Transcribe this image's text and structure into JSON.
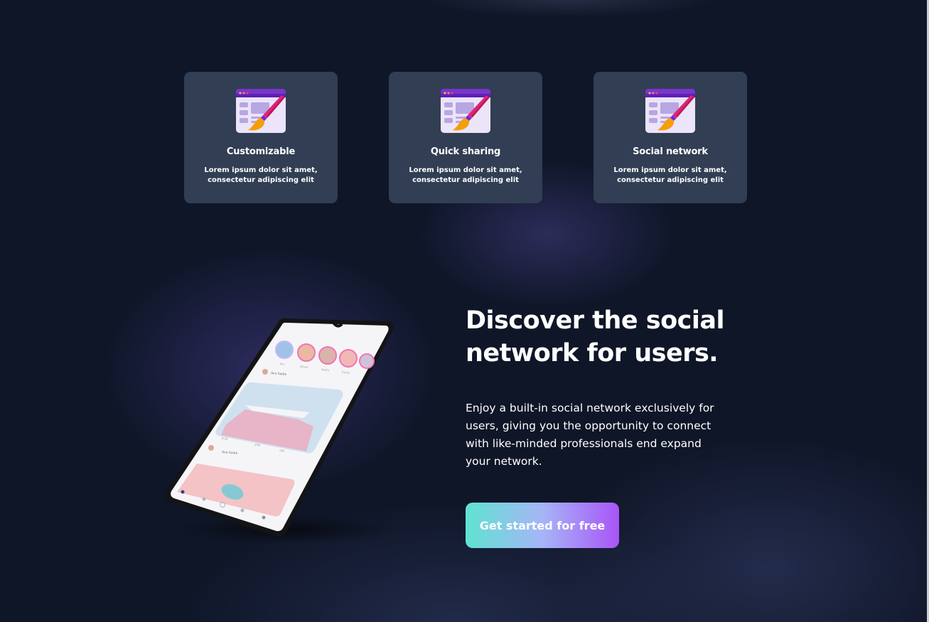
{
  "features": [
    {
      "title": "Customizable",
      "text": "Lorem ipsum dolor sit amet,\nconsectetur adipiscing elit",
      "icon": "browser-paintbrush-icon"
    },
    {
      "title": "Quick sharing",
      "text": "Lorem ipsum dolor sit amet,\nconsectetur adipiscing elit",
      "icon": "browser-paintbrush-icon"
    },
    {
      "title": "Social network",
      "text": "Lorem ipsum dolor sit amet,\nconsectetur adipiscing elit",
      "icon": "browser-paintbrush-icon"
    }
  ],
  "hero": {
    "title": "Discover the social\nnetwork for users.",
    "text": "Enjoy a built-in social network exclusively for\nusers, giving you the opportunity to connect\nwith like-minded professionals end expand\nyour network.",
    "cta_label": "Get started for free"
  },
  "phone": {
    "stories": [
      "You",
      "Olivia",
      "Avery",
      "Emily"
    ],
    "posts": [
      {
        "author": "Ava Sadie",
        "likes": "6.2k",
        "comments": "278",
        "shares": "22k"
      },
      {
        "author": "Ava Sadie"
      }
    ]
  },
  "colors": {
    "background": "#0f1628",
    "card": "#313e54",
    "cta_gradient": [
      "#5fe3d2",
      "#a6b5f7",
      "#a855f7"
    ]
  }
}
